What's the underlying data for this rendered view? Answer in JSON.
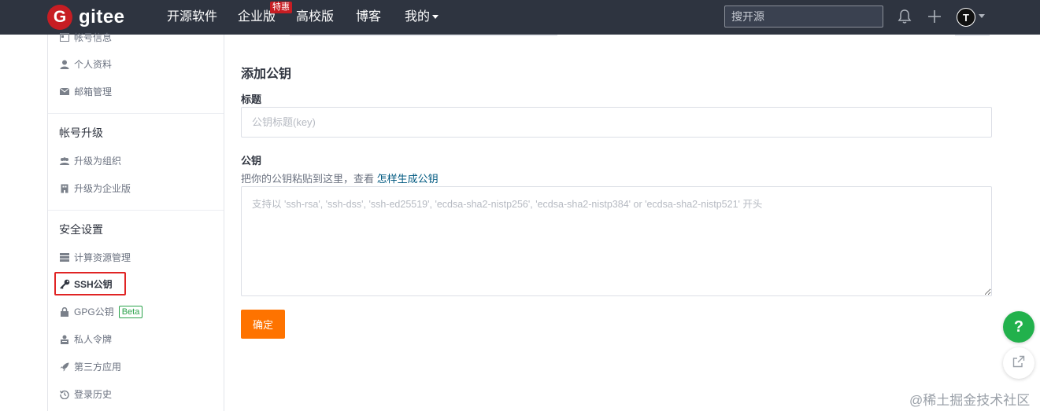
{
  "header": {
    "logo_mark": "G",
    "logo_text": "gitee",
    "nav": [
      "开源软件",
      "企业版",
      "高校版",
      "博客",
      "我的"
    ],
    "badge": "特惠",
    "search_placeholder": "搜开源",
    "avatar_initial": "T",
    "icons": [
      "bell-icon",
      "plus-icon",
      "caret-down-icon"
    ]
  },
  "sidebar": {
    "account_items": [
      {
        "label": "帐号信息",
        "icon": "id-card-icon"
      },
      {
        "label": "个人资料",
        "icon": "user-icon"
      },
      {
        "label": "邮箱管理",
        "icon": "mail-icon"
      }
    ],
    "upgrade_heading": "帐号升级",
    "upgrade_items": [
      {
        "label": "升级为组织",
        "icon": "users-icon"
      },
      {
        "label": "升级为企业版",
        "icon": "building-icon"
      }
    ],
    "security_heading": "安全设置",
    "security_items": [
      {
        "label": "计算资源管理",
        "icon": "server-icon"
      },
      {
        "label": "SSH公钥",
        "icon": "key-icon"
      },
      {
        "label": "GPG公钥",
        "icon": "lock-icon",
        "badge": "Beta"
      },
      {
        "label": "私人令牌",
        "icon": "token-icon"
      },
      {
        "label": "第三方应用",
        "icon": "rocket-icon"
      },
      {
        "label": "登录历史",
        "icon": "history-icon"
      }
    ]
  },
  "form": {
    "section_title": "添加公钥",
    "title_label": "标题",
    "title_placeholder": "公钥标题(key)",
    "key_label": "公钥",
    "hint_text": "把你的公钥粘贴到这里，查看 ",
    "hint_link": "怎样生成公钥",
    "key_placeholder": "支持以 'ssh-rsa', 'ssh-dss', 'ssh-ed25519', 'ecdsa-sha2-nistp256', 'ecdsa-sha2-nistp384' or 'ecdsa-sha2-nistp521' 开头",
    "confirm_label": "确定"
  },
  "floating": {
    "help_label": "?",
    "watermark": "@稀土掘金技术社区"
  },
  "colors": {
    "topbar": "#2e3440",
    "brand_red": "#c71d23",
    "confirm_orange": "#fe7300",
    "help_green": "#22b14c",
    "link": "#005980"
  }
}
